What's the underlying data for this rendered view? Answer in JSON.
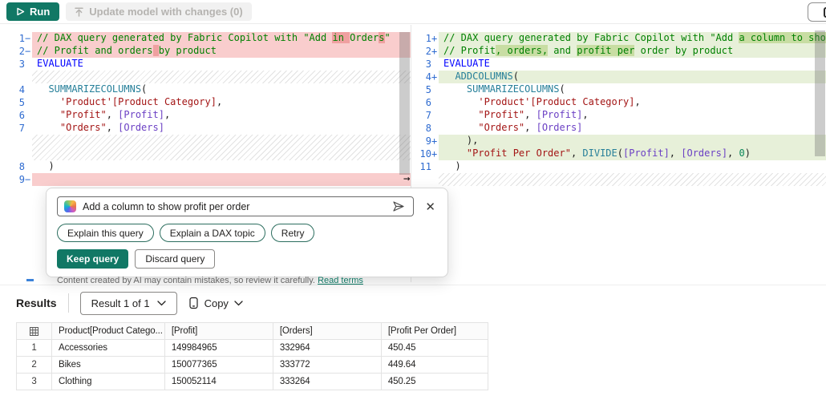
{
  "colors": {
    "accent": "#117865",
    "removed_line": "#f9cdcd",
    "removed_word": "#efa0a0",
    "added_line": "#e7f0d9",
    "added_word": "#c8dda3",
    "comment": "#008000",
    "keyword": "#0000ff",
    "func": "#267f99",
    "string": "#a31515",
    "column": "#6b40c4",
    "number": "#098658",
    "line_number": "#2e6bd0"
  },
  "toolbar": {
    "run_label": "Run",
    "update_label": "Update model with changes (0)"
  },
  "editor": {
    "left_lines": [
      {
        "n": "1",
        "m": "−",
        "state": "removed",
        "segs": [
          {
            "t": "// DAX query generated by Fabric Copilot with \"Add ",
            "c": "comment"
          },
          {
            "t": "in ",
            "c": "comment",
            "h": true
          },
          {
            "t": "Order",
            "c": "comment"
          },
          {
            "t": "s",
            "c": "comment",
            "h": true
          },
          {
            "t": "\"",
            "c": "comment"
          }
        ]
      },
      {
        "n": "2",
        "m": "−",
        "state": "removed",
        "segs": [
          {
            "t": "// Profit and orders",
            "c": "comment"
          },
          {
            "t": " ",
            "c": "comment",
            "h": true
          },
          {
            "t": "by product",
            "c": "comment"
          }
        ]
      },
      {
        "n": "3",
        "m": "",
        "state": "",
        "segs": [
          {
            "t": "EVALUATE",
            "c": "keyword"
          }
        ]
      },
      {
        "filler": true,
        "span": 1
      },
      {
        "n": "4",
        "m": "",
        "state": "",
        "segs": [
          {
            "t": "  ",
            "c": "plain"
          },
          {
            "t": "SUMMARIZECOLUMNS",
            "c": "func"
          },
          {
            "t": "(",
            "c": "plain"
          }
        ]
      },
      {
        "n": "5",
        "m": "",
        "state": "",
        "segs": [
          {
            "t": "    ",
            "c": "plain"
          },
          {
            "t": "'Product'[Product Category]",
            "c": "string"
          },
          {
            "t": ",",
            "c": "plain"
          }
        ]
      },
      {
        "n": "6",
        "m": "",
        "state": "",
        "segs": [
          {
            "t": "    ",
            "c": "plain"
          },
          {
            "t": "\"Profit\"",
            "c": "string"
          },
          {
            "t": ", ",
            "c": "plain"
          },
          {
            "t": "[Profit]",
            "c": "col"
          },
          {
            "t": ",",
            "c": "plain"
          }
        ]
      },
      {
        "n": "7",
        "m": "",
        "state": "",
        "segs": [
          {
            "t": "    ",
            "c": "plain"
          },
          {
            "t": "\"Orders\"",
            "c": "string"
          },
          {
            "t": ", ",
            "c": "plain"
          },
          {
            "t": "[Orders]",
            "c": "col"
          }
        ]
      },
      {
        "filler": true,
        "span": 2
      },
      {
        "n": "8",
        "m": "",
        "state": "",
        "segs": [
          {
            "t": "  )",
            "c": "plain"
          }
        ]
      },
      {
        "n": "9",
        "m": "−",
        "state": "removed",
        "segs": []
      }
    ],
    "right_lines": [
      {
        "n": "1",
        "m": "+",
        "state": "added",
        "segs": [
          {
            "t": "// DAX query generated by Fabric Copilot with \"Add ",
            "c": "comment"
          },
          {
            "t": "a column to show profit per",
            "c": "comment",
            "h": true
          }
        ]
      },
      {
        "n": "2",
        "m": "+",
        "state": "added",
        "segs": [
          {
            "t": "// Profit",
            "c": "comment"
          },
          {
            "t": ", orders,",
            "c": "comment",
            "h": true
          },
          {
            "t": " and ",
            "c": "comment"
          },
          {
            "t": "profit per",
            "c": "comment",
            "h": true
          },
          {
            "t": " order by product",
            "c": "comment"
          }
        ]
      },
      {
        "n": "3",
        "m": "",
        "state": "",
        "segs": [
          {
            "t": "EVALUATE",
            "c": "keyword"
          }
        ]
      },
      {
        "n": "4",
        "m": "+",
        "state": "added",
        "segs": [
          {
            "t": "  ",
            "c": "plain"
          },
          {
            "t": "ADDCOLUMNS",
            "c": "func"
          },
          {
            "t": "(",
            "c": "plain"
          }
        ]
      },
      {
        "n": "5",
        "m": "",
        "state": "",
        "segs": [
          {
            "t": "    ",
            "c": "plain"
          },
          {
            "t": "SUMMARIZECOLUMNS",
            "c": "func"
          },
          {
            "t": "(",
            "c": "plain"
          }
        ]
      },
      {
        "n": "6",
        "m": "",
        "state": "",
        "segs": [
          {
            "t": "      ",
            "c": "plain"
          },
          {
            "t": "'Product'[Product Category]",
            "c": "string"
          },
          {
            "t": ",",
            "c": "plain"
          }
        ]
      },
      {
        "n": "7",
        "m": "",
        "state": "",
        "segs": [
          {
            "t": "      ",
            "c": "plain"
          },
          {
            "t": "\"Profit\"",
            "c": "string"
          },
          {
            "t": ", ",
            "c": "plain"
          },
          {
            "t": "[Profit]",
            "c": "col"
          },
          {
            "t": ",",
            "c": "plain"
          }
        ]
      },
      {
        "n": "8",
        "m": "",
        "state": "",
        "segs": [
          {
            "t": "      ",
            "c": "plain"
          },
          {
            "t": "\"Orders\"",
            "c": "string"
          },
          {
            "t": ", ",
            "c": "plain"
          },
          {
            "t": "[Orders]",
            "c": "col"
          }
        ]
      },
      {
        "n": "9",
        "m": "+",
        "state": "added",
        "segs": [
          {
            "t": "    ),",
            "c": "plain"
          }
        ]
      },
      {
        "n": "10",
        "m": "+",
        "state": "added",
        "segs": [
          {
            "t": "    ",
            "c": "plain"
          },
          {
            "t": "\"Profit Per Order\"",
            "c": "string"
          },
          {
            "t": ", ",
            "c": "plain"
          },
          {
            "t": "DIVIDE",
            "c": "func"
          },
          {
            "t": "(",
            "c": "plain"
          },
          {
            "t": "[Profit]",
            "c": "col"
          },
          {
            "t": ", ",
            "c": "plain"
          },
          {
            "t": "[Orders]",
            "c": "col"
          },
          {
            "t": ", ",
            "c": "plain"
          },
          {
            "t": "0",
            "c": "num"
          },
          {
            "t": ")",
            "c": "plain"
          }
        ]
      },
      {
        "n": "11",
        "m": "",
        "state": "",
        "segs": [
          {
            "t": "  )",
            "c": "plain"
          }
        ]
      },
      {
        "filler": true,
        "span": 1
      }
    ],
    "gutter_arrow": "→"
  },
  "copilot": {
    "prompt": "Add a column to show profit per order",
    "pills": [
      "Explain this query",
      "Explain a DAX topic",
      "Retry"
    ],
    "keep_label": "Keep query",
    "discard_label": "Discard query",
    "disclaimer": "Content created by AI may contain mistakes, so review it carefully.",
    "read_terms_label": "Read terms",
    "close_label": "✕"
  },
  "results": {
    "title": "Results",
    "selector_label": "Result 1 of 1",
    "copy_label": "Copy",
    "table": {
      "headers": [
        "Product[Product Catego...",
        "[Profit]",
        "[Orders]",
        "[Profit Per Order]"
      ],
      "rows": [
        [
          "1",
          "Accessories",
          "149984965",
          "332964",
          "450.45"
        ],
        [
          "2",
          "Bikes",
          "150077365",
          "333772",
          "449.64"
        ],
        [
          "3",
          "Clothing",
          "150052114",
          "333264",
          "450.25"
        ]
      ]
    }
  }
}
